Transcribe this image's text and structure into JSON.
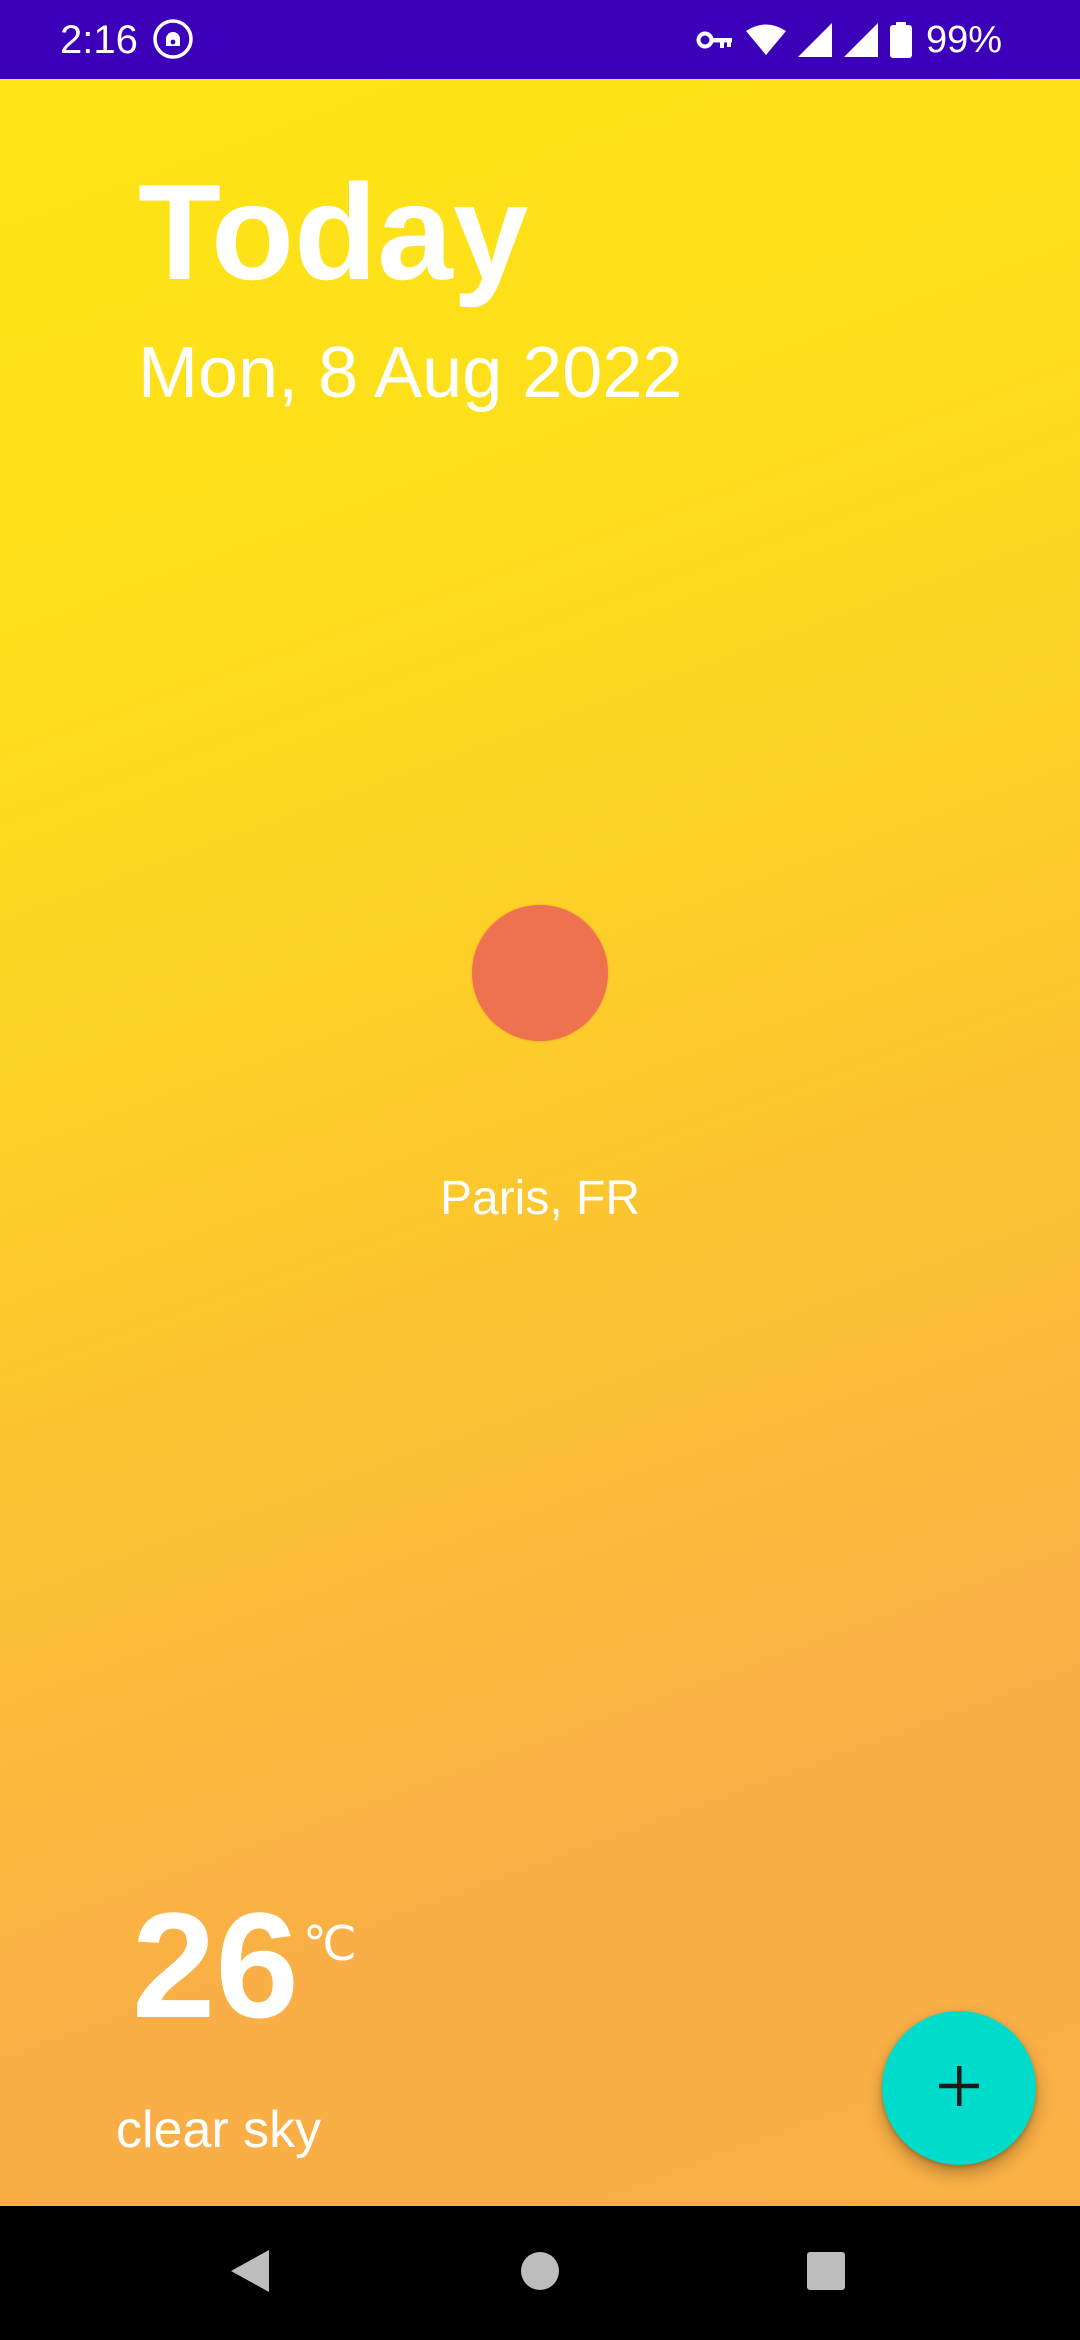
{
  "status_bar": {
    "time": "2:16",
    "battery_percent": "99%",
    "icons": [
      "vpn-app-icon",
      "key-icon",
      "wifi-icon",
      "signal-icon",
      "signal-icon",
      "battery-icon"
    ],
    "background_color": "#3c00b8"
  },
  "header": {
    "title": "Today",
    "date": "Mon, 8 Aug 2022"
  },
  "weather": {
    "icon": "sun-icon",
    "icon_color": "#ee7150",
    "location": "Paris, FR",
    "temperature": "26",
    "unit": "℃",
    "condition": "clear sky"
  },
  "fab": {
    "icon": "plus-icon",
    "color": "#00dccb"
  },
  "nav_bar": {
    "buttons": [
      "back-icon",
      "home-icon",
      "recents-icon"
    ]
  },
  "colors": {
    "gradient_top": "#fee416",
    "gradient_bottom": "#f9b045",
    "text": "#ffffff"
  }
}
